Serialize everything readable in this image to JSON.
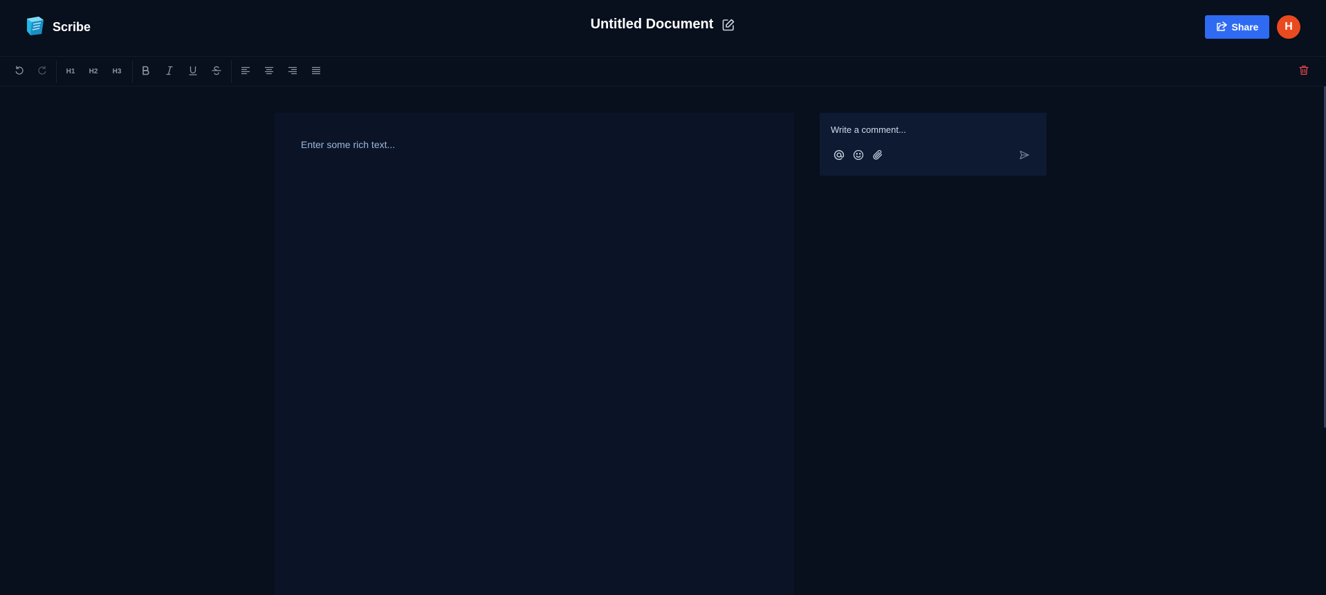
{
  "app": {
    "name": "Scribe"
  },
  "document": {
    "title": "Untitled Document"
  },
  "header": {
    "share_label": "Share",
    "avatar_initial": "H"
  },
  "toolbar": {
    "h1": "H1",
    "h2": "H2",
    "h3": "H3"
  },
  "editor": {
    "placeholder": "Enter some rich text..."
  },
  "comment": {
    "placeholder": "Write a comment..."
  },
  "icons": {
    "logo": "book-logo-icon",
    "edit_title": "edit-icon",
    "share": "share-icon",
    "undo": "undo-icon",
    "redo": "redo-icon",
    "bold": "bold-icon",
    "italic": "italic-icon",
    "underline": "underline-icon",
    "strike": "strikethrough-icon",
    "align_left": "align-left-icon",
    "align_center": "align-center-icon",
    "align_right": "align-right-icon",
    "justify": "align-justify-icon",
    "delete": "trash-icon",
    "mention": "at-icon",
    "emoji": "smiley-icon",
    "attach": "paperclip-icon",
    "send": "send-icon"
  },
  "colors": {
    "accent": "#2f6bf2",
    "avatar": "#ea4a1f",
    "danger": "#e5484d",
    "background": "#080f1d"
  }
}
